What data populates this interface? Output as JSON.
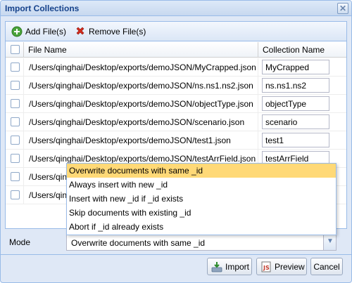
{
  "dialog": {
    "title": "Import Collections",
    "close_glyph": "✕"
  },
  "toolbar": {
    "add_label": "Add File(s)",
    "remove_label": "Remove File(s)"
  },
  "grid": {
    "headers": {
      "file_name": "File Name",
      "collection_name": "Collection Name"
    },
    "rows": [
      {
        "path": "/Users/qinghai/Desktop/exports/demoJSON/MyCrapped.json",
        "collection": "MyCrapped"
      },
      {
        "path": "/Users/qinghai/Desktop/exports/demoJSON/ns.ns1.ns2.json",
        "collection": "ns.ns1.ns2"
      },
      {
        "path": "/Users/qinghai/Desktop/exports/demoJSON/objectType.json",
        "collection": "objectType"
      },
      {
        "path": "/Users/qinghai/Desktop/exports/demoJSON/scenario.json",
        "collection": "scenario"
      },
      {
        "path": "/Users/qinghai/Desktop/exports/demoJSON/test1.json",
        "collection": "test1"
      },
      {
        "path": "/Users/qinghai/Desktop/exports/demoJSON/testArrField.json",
        "collection": "testArrField"
      },
      {
        "path": "/Users/qin",
        "collection": ""
      },
      {
        "path": "/Users/qin",
        "collection": ""
      }
    ]
  },
  "mode": {
    "label": "Mode",
    "selected": "Overwrite documents with same _id",
    "options": [
      "Overwrite documents with same _id",
      "Always insert with new _id",
      "Insert with new _id if _id exists",
      "Skip documents with existing _id",
      "Abort if _id already exists"
    ]
  },
  "buttons": {
    "import": "Import",
    "preview": "Preview",
    "cancel": "Cancel"
  },
  "colors": {
    "selected_option": "#ffd977",
    "border": "#99bbe8",
    "title_text": "#15428b"
  },
  "icons": {
    "add": "green-plus-icon",
    "remove": "red-x-icon",
    "import": "import-icon",
    "preview": "preview-icon"
  }
}
